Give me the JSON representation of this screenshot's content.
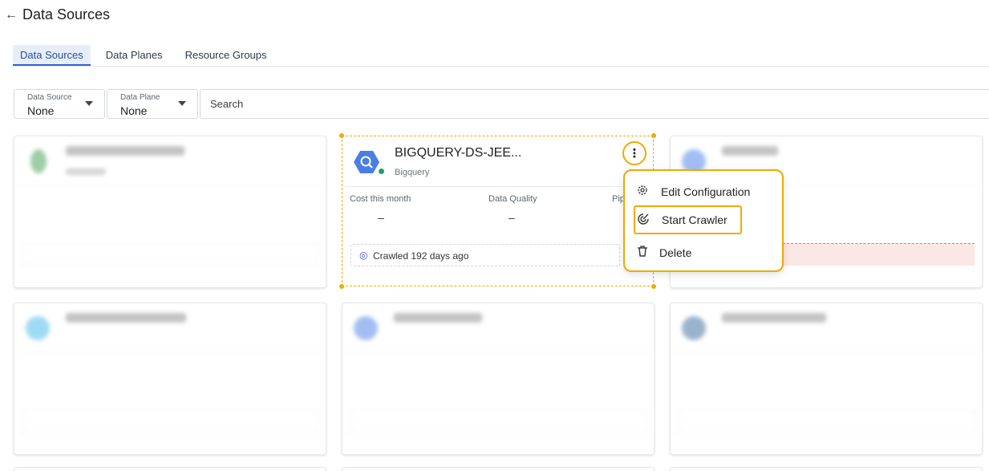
{
  "header": {
    "back_icon": "arrow-left-icon",
    "title": "Data Sources"
  },
  "tabs": [
    {
      "label": "Data Sources",
      "active": true
    },
    {
      "label": "Data Planes",
      "active": false
    },
    {
      "label": "Resource Groups",
      "active": false
    }
  ],
  "filters": {
    "data_source": {
      "label": "Data Source",
      "value": "None"
    },
    "data_plane": {
      "label": "Data Plane",
      "value": "None"
    },
    "search": {
      "placeholder": "Search"
    }
  },
  "card": {
    "name": "BIGQUERY-DS-JEE...",
    "type": "Bigquery",
    "metrics": [
      {
        "label": "Cost this month",
        "value": "–"
      },
      {
        "label": "Data Quality",
        "value": "–"
      },
      {
        "label": "Pip"
      }
    ],
    "crawl_status": "Crawled 192 days ago",
    "status_color": "#1f9d6a"
  },
  "context_menu": {
    "items": [
      {
        "label": "Edit Configuration",
        "icon": "gear-icon"
      },
      {
        "label": "Start Crawler",
        "icon": "crawler-icon",
        "highlighted": true
      },
      {
        "label": "Delete",
        "icon": "trash-icon"
      }
    ]
  },
  "colors": {
    "highlight": "#f2a900",
    "accent": "#2f64d0",
    "bigquery": "#4a7ee6"
  }
}
